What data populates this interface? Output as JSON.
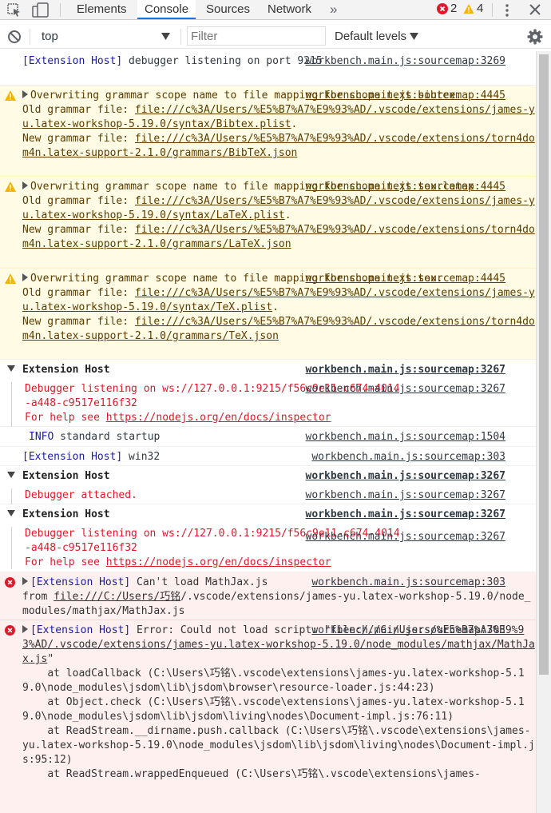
{
  "tabs": [
    "Elements",
    "Console",
    "Sources",
    "Network"
  ],
  "counts": {
    "errors": "2",
    "warnings": "4"
  },
  "toolbar": {
    "context": "top",
    "filter_placeholder": "Filter",
    "levels": "Default levels"
  },
  "messages": {
    "m1": {
      "prefix": "[Extension Host]",
      "text": " debugger listening on port 9215",
      "src": "workbench.main.js:sourcemap:3269"
    },
    "w1": {
      "l1": "Overwriting grammar scope name to file mapping for scope text.bibtex.",
      "old_label": "Old grammar file: ",
      "old": "file:///c%3A/Users/%E5%B7%A7%E9%93%AD/.vscode/extensions/james-yu.latex-workshop-5.19.0/syntax/Bibtex.plist",
      "new_label": "New grammar file: ",
      "new": "file:///c%3A/Users/%E5%B7%A7%E9%93%AD/.vscode/extensions/torn4dom4n.latex-support-2.1.0/grammars/BibTeX.json",
      "src": "workbench.main.js:sourcemap:4445"
    },
    "w2": {
      "l1": "Overwriting grammar scope name to file mapping for scope text.tex.latex.",
      "old_label": "Old grammar file: ",
      "old": "file:///c%3A/Users/%E5%B7%A7%E9%93%AD/.vscode/extensions/james-yu.latex-workshop-5.19.0/syntax/LaTeX.plist",
      "new_label": "New grammar file: ",
      "new": "file:///c%3A/Users/%E5%B7%A7%E9%93%AD/.vscode/extensions/torn4dom4n.latex-support-2.1.0/grammars/LaTeX.json",
      "src": "workbench.main.js:sourcemap:4445"
    },
    "w3": {
      "l1": "Overwriting grammar scope name to file mapping for scope text.tex.",
      "old_label": "Old grammar file: ",
      "old": "file:///c%3A/Users/%E5%B7%A7%E9%93%AD/.vscode/extensions/james-yu.latex-workshop-5.19.0/syntax/TeX.plist",
      "new_label": "New grammar file: ",
      "new": "file:///c%3A/Users/%E5%B7%A7%E9%93%AD/.vscode/extensions/torn4dom4n.latex-support-2.1.0/grammars/TeX.json",
      "src": "workbench.main.js:sourcemap:4445"
    },
    "g1": {
      "title": "Extension Host",
      "src": "workbench.main.js:sourcemap:3267",
      "child_text": "Debugger listening on ws://127.0.0.1:9215/f56c9e11-c674-4014-a448-c9517e116f32\nFor help see ",
      "child_link": "https://nodejs.org/en/docs/inspector",
      "child_src": "workbench.main.js:sourcemap:3267"
    },
    "info": {
      "label": "INFO",
      "text": " standard startup",
      "src": "workbench.main.js:sourcemap:1504"
    },
    "m2": {
      "prefix": "[Extension Host]",
      "text": " win32",
      "src": "workbench.main.js:sourcemap:303"
    },
    "g2": {
      "title": "Extension Host",
      "src": "workbench.main.js:sourcemap:3267",
      "child_text": "Debugger attached.",
      "child_src": "workbench.main.js:sourcemap:3267"
    },
    "g3": {
      "title": "Extension Host",
      "src": "workbench.main.js:sourcemap:3267",
      "child_text": "Debugger listening on ws://127.0.0.1:9215/f56c9e11-c674-4014-a448-c9517e116f32\nFor help see ",
      "child_link": "https://nodejs.org/en/docs/inspector",
      "child_src": "workbench.main.js:sourcemap:3267"
    },
    "e1": {
      "prefix": "[Extension Host]",
      "text1": " Can't load MathJax.js\nfrom ",
      "link": "file:///C:/Users/巧铭",
      "text2": "/.vscode/extensions/james-yu.latex-workshop-5.19.0/node_modules/mathjax/MathJax.js",
      "src": "workbench.main.js:sourcemap:303"
    },
    "e2": {
      "prefix": "[Extension Host]",
      "text1": " Error: Could not load script: \"",
      "link": "file:///C:/Users/%E5%B7%A7%E9%93%AD/.vscode/extensions/james-yu.latex-workshop-5.19.0/node_modules/mathjax/MathJax.js",
      "text2": "\"\n    at loadCallback (C:\\Users\\巧铭\\.vscode\\extensions\\james-yu.latex-workshop-5.19.0\\node_modules\\jsdom\\lib\\jsdom\\browser\\resource-loader.js:44:23)\n    at Object.check (C:\\Users\\巧铭\\.vscode\\extensions\\james-yu.latex-workshop-5.19.0\\node_modules\\jsdom\\lib\\jsdom\\living\\nodes\\Document-impl.js:76:11)\n    at ReadStream.__dirname.push.callback (C:\\Users\\巧铭\\.vscode\\extensions\\james-yu.latex-workshop-5.19.0\\node_modules\\jsdom\\lib\\jsdom\\living\\nodes\\Document-impl.js:95:12)\n    at ReadStream.wrappedEnqueued (C:\\Users\\巧铭\\.vscode\\extensions\\james-",
      "src": "workbench.main.js:sourcemap:303"
    }
  },
  "colors": {
    "accent": "#1a73e8",
    "error": "#e0182a",
    "warning": "#f4b400"
  }
}
